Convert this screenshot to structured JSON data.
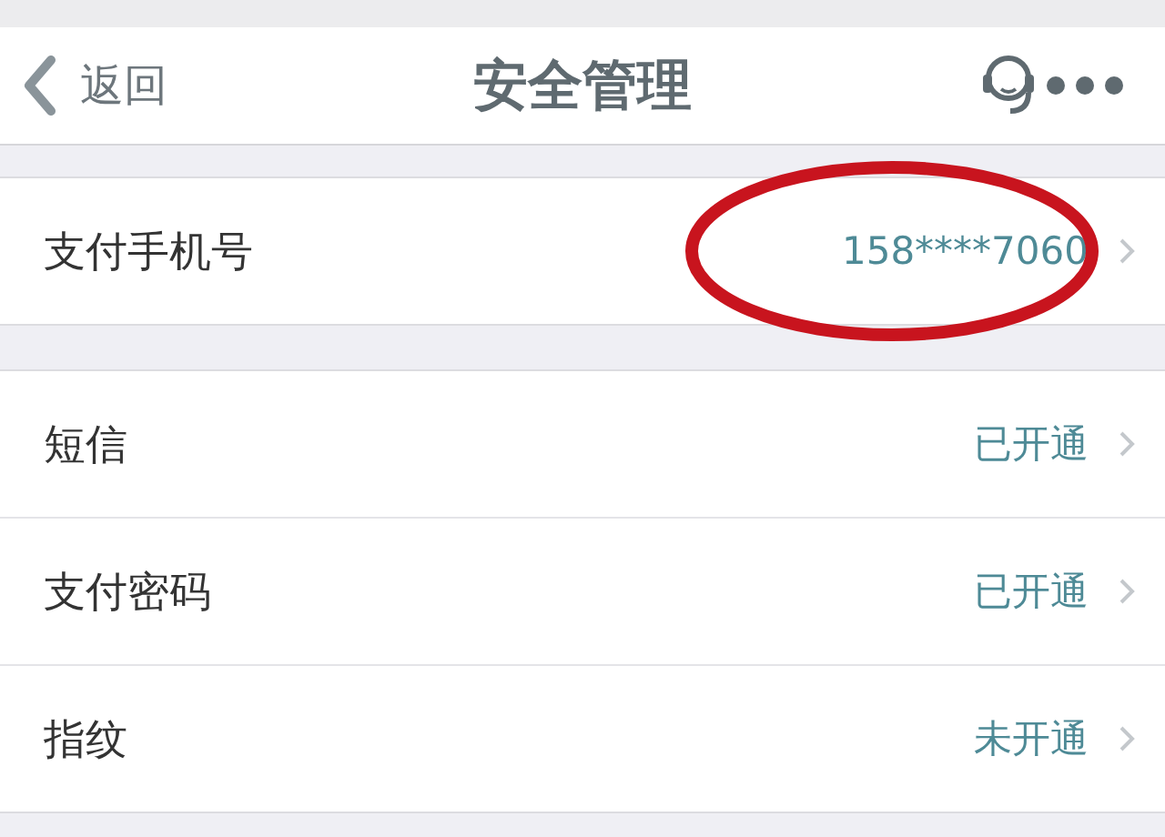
{
  "nav_bar": {
    "back_label": "返回",
    "title": "安全管理"
  },
  "groups": [
    {
      "items": [
        {
          "label": "支付手机号",
          "value": "158****7060",
          "circled": true
        }
      ]
    },
    {
      "items": [
        {
          "label": "短信",
          "value": "已开通",
          "circled": false
        },
        {
          "label": "支付密码",
          "value": "已开通",
          "circled": false
        },
        {
          "label": "指纹",
          "value": "未开通",
          "circled": false
        }
      ]
    }
  ]
}
